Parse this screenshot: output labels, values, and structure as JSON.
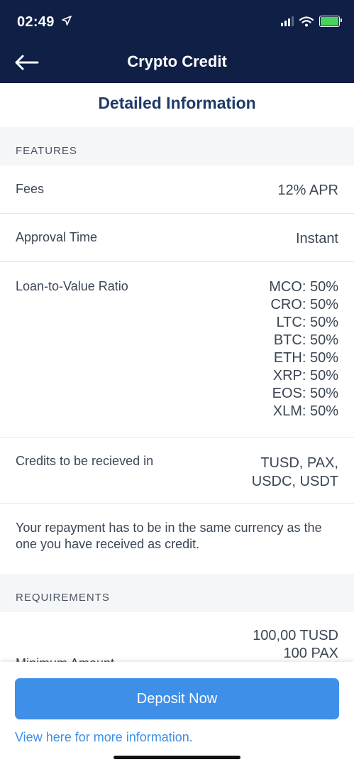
{
  "status_bar": {
    "time": "02:49",
    "icons": [
      "location-arrow-icon",
      "signal-icon",
      "wifi-icon",
      "battery-charging-icon"
    ],
    "battery_color": "#48d35b"
  },
  "nav": {
    "title": "Crypto Credit",
    "back_icon": "arrow-left-icon",
    "background": "#0f1f45"
  },
  "heading": "Detailed Information",
  "features": {
    "header": "FEATURES",
    "fees": {
      "label": "Fees",
      "value": "12% APR"
    },
    "approval_time": {
      "label": "Approval Time",
      "value": "Instant"
    },
    "ltv": {
      "label": "Loan-to-Value Ratio",
      "values": [
        "MCO: 50%",
        "CRO: 50%",
        "LTC: 50%",
        "BTC: 50%",
        "ETH: 50%",
        "XRP: 50%",
        "EOS: 50%",
        "XLM: 50%"
      ]
    },
    "credits": {
      "label": "Credits to be recieved in",
      "values": [
        "TUSD, PAX,",
        "USDC, USDT"
      ]
    },
    "note": "Your repayment has to be in the same currency as the one you have received as credit."
  },
  "requirements": {
    "header": "REQUIREMENTS",
    "minimum_amount": {
      "label": "Minimum Amount",
      "values": [
        "100,00 TUSD",
        "100 PAX"
      ]
    }
  },
  "footer": {
    "deposit_label": "Deposit Now",
    "more_info_link": "View here for more information.",
    "accent_color": "#3d8fe8"
  }
}
